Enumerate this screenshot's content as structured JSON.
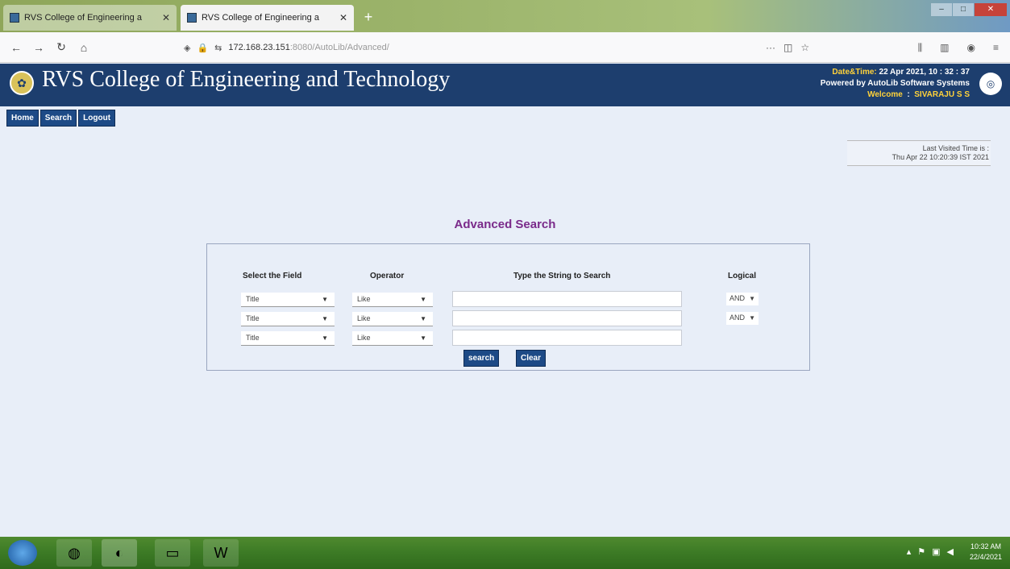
{
  "browser": {
    "tabs": [
      {
        "title": "RVS College of Engineering a",
        "active": false
      },
      {
        "title": "RVS College of Engineering a",
        "active": true
      }
    ],
    "url": "172.168.23.151",
    "url_rest": ":8080/AutoLib/Advanced/"
  },
  "header": {
    "college_name": "RVS College of Engineering and Technology",
    "datetime_label": "Date&Time:",
    "datetime_value": "22 Apr 2021, 10 : 32 : 37",
    "powered_by": "Powered by AutoLib Software Systems",
    "welcome_label": "Welcome",
    "welcome_user": "SIVARAJU S S"
  },
  "menu": {
    "home": "Home",
    "search": "Search",
    "logout": "Logout"
  },
  "last_visit": {
    "label": "Last Visited Time is :",
    "value": "Thu Apr 22 10:20:39 IST 2021"
  },
  "advanced_search": {
    "title": "Advanced Search",
    "col_field": "Select the Field",
    "col_operator": "Operator",
    "col_string": "Type the String to Search",
    "col_logical": "Logical",
    "rows": [
      {
        "field": "Title",
        "operator": "Like",
        "logical": "AND"
      },
      {
        "field": "Title",
        "operator": "Like",
        "logical": "AND"
      },
      {
        "field": "Title",
        "operator": "Like"
      }
    ],
    "search_button": "search",
    "clear_button": "Clear"
  },
  "taskbar": {
    "time": "10:32 AM",
    "date": "22/4/2021"
  }
}
